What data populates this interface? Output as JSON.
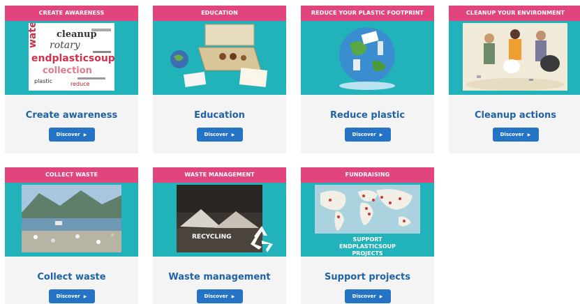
{
  "cards": [
    {
      "header": "CREATE AWARENESS",
      "title": "Create awareness",
      "button": "Discover"
    },
    {
      "header": "EDUCATION",
      "title": "Education",
      "button": "Discover"
    },
    {
      "header": "REDUCE YOUR PLASTIC FOOTPRINT",
      "title": "Reduce plastic",
      "button": "Discover"
    },
    {
      "header": "CLEANUP YOUR ENVIRONMENT",
      "title": "Cleanup actions",
      "button": "Discover"
    },
    {
      "header": "COLLECT WASTE",
      "title": "Collect waste",
      "button": "Discover"
    },
    {
      "header": "WASTE MANAGEMENT",
      "title": "Waste management",
      "button": "Discover",
      "image_text": "RECYCLING"
    },
    {
      "header": "FUNDRAISING",
      "title": "Support projects",
      "button": "Discover",
      "image_text": "SUPPORT ENDPLASTICSOUP PROJECTS"
    }
  ],
  "wordcloud": [
    "endplasticsoup",
    "rotary",
    "cleanup",
    "collection",
    "water",
    "plastic",
    "reduce"
  ],
  "colors": {
    "header": "#e2457e",
    "band": "#21b3b9",
    "title": "#1f62a6",
    "button": "#2473c5"
  }
}
